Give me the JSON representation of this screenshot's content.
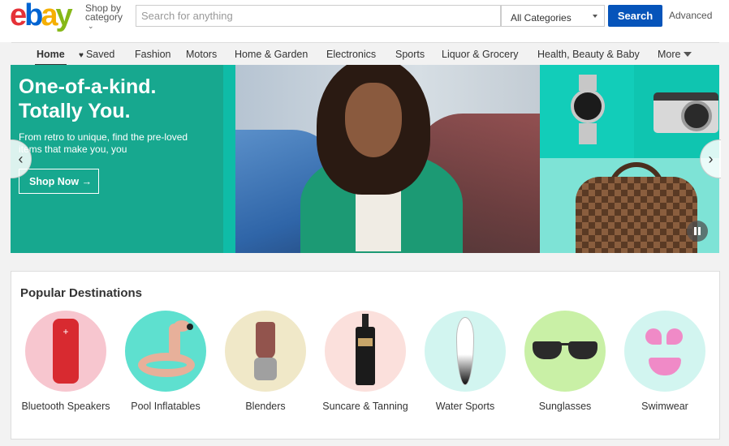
{
  "header": {
    "logo_letters": [
      {
        "char": "e",
        "color": "#e53238"
      },
      {
        "char": "b",
        "color": "#0064d2"
      },
      {
        "char": "a",
        "color": "#f5af02"
      },
      {
        "char": "y",
        "color": "#86b817"
      }
    ],
    "shop_by_line1": "Shop by",
    "shop_by_line2": "category",
    "search_placeholder": "Search for anything",
    "search_value": "",
    "category_selected": "All Categories",
    "search_button": "Search",
    "advanced": "Advanced",
    "colors": {
      "search_button": "#0654ba"
    }
  },
  "nav": {
    "items": [
      {
        "label": "Home",
        "active": true
      },
      {
        "label": "Saved",
        "icon": "heart-icon"
      },
      {
        "label": "Fashion"
      },
      {
        "label": "Motors"
      },
      {
        "label": "Home & Garden"
      },
      {
        "label": "Electronics"
      },
      {
        "label": "Sports"
      },
      {
        "label": "Liquor & Grocery"
      },
      {
        "label": "Health, Beauty & Baby"
      },
      {
        "label": "More",
        "icon": "caret-down-icon"
      }
    ]
  },
  "hero": {
    "title_line1": "One-of-a-kind.",
    "title_line2": "Totally You.",
    "subtitle": "From retro to unique, find the pre-loved items that make you, you",
    "cta": "Shop Now",
    "cta_arrow": "→",
    "prev_icon": "chevron-left-icon",
    "next_icon": "chevron-right-icon",
    "pause_icon": "pause-icon",
    "colors": {
      "panel": "#17a88f"
    }
  },
  "popular": {
    "title": "Popular Destinations",
    "items": [
      {
        "label": "Bluetooth Speakers",
        "bg": "#f7c6cf",
        "icon": "speaker-icon"
      },
      {
        "label": "Pool Inflatables",
        "bg": "#5ee0cf",
        "icon": "flamingo-float-icon"
      },
      {
        "label": "Blenders",
        "bg": "#f0e8c8",
        "icon": "blender-icon"
      },
      {
        "label": "Suncare & Tanning",
        "bg": "#fbe0dc",
        "icon": "tanning-bottle-icon"
      },
      {
        "label": "Water Sports",
        "bg": "#d2f5f0",
        "icon": "surfboard-icon"
      },
      {
        "label": "Sunglasses",
        "bg": "#c9f0a6",
        "icon": "sunglasses-icon"
      },
      {
        "label": "Swimwear",
        "bg": "#d2f5f0",
        "icon": "bikini-icon"
      }
    ]
  }
}
